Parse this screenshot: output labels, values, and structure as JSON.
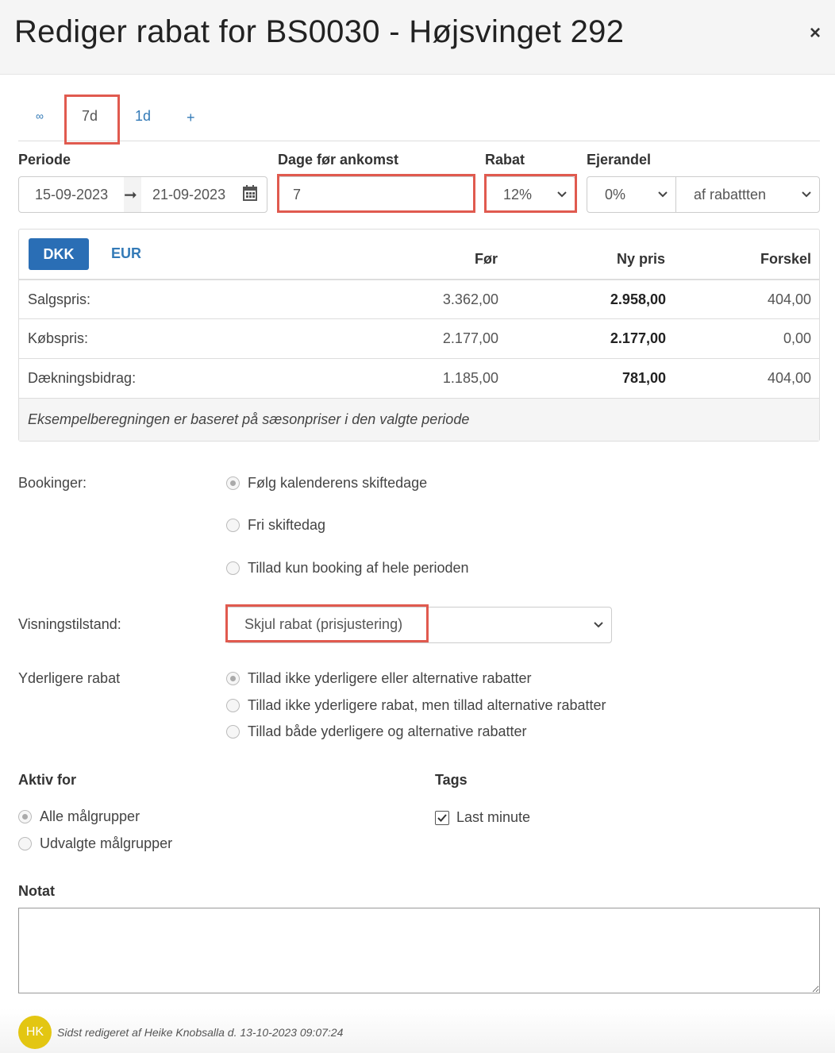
{
  "dialog": {
    "title": "Rediger rabat for BS0030 - Højsvinget 292",
    "close": "×"
  },
  "tabs": [
    {
      "label": "∞"
    },
    {
      "label": "7d",
      "active": true
    },
    {
      "label": "1d"
    },
    {
      "label": "+"
    }
  ],
  "fields": {
    "periode_label": "Periode",
    "date_from": "15-09-2023",
    "date_to": "21-09-2023",
    "dage_label": "Dage før ankomst",
    "dage_value": "7",
    "rabat_label": "Rabat",
    "rabat_value": "12%",
    "ejerandel_label": "Ejerandel",
    "ejerandel_value": "0%",
    "ejerandel_basis": "af rabattten"
  },
  "price_table": {
    "currencies": [
      "DKK",
      "EUR"
    ],
    "active_currency": "DKK",
    "headers": [
      "Før",
      "Ny pris",
      "Forskel"
    ],
    "rows": [
      {
        "label": "Salgspris:",
        "before": "3.362,00",
        "new": "2.958,00",
        "diff": "404,00"
      },
      {
        "label": "Købspris:",
        "before": "2.177,00",
        "new": "2.177,00",
        "diff": "0,00"
      },
      {
        "label": "Dækningsbidrag:",
        "before": "1.185,00",
        "new": "781,00",
        "diff": "404,00"
      }
    ],
    "note": "Eksempelberegningen er baseret på sæsonpriser i den valgte periode"
  },
  "bookinger": {
    "label": "Bookinger:",
    "options": [
      "Følg kalenderens skiftedage",
      "Fri skiftedag",
      "Tillad kun booking af hele perioden"
    ],
    "selected": 0
  },
  "visning": {
    "label": "Visningstilstand:",
    "value": "Skjul rabat (prisjustering)"
  },
  "yderligere": {
    "label": "Yderligere rabat",
    "options": [
      "Tillad ikke yderligere eller alternative rabatter",
      "Tillad ikke yderligere rabat, men tillad alternative rabatter",
      "Tillad både yderligere og alternative rabatter"
    ],
    "selected": 0
  },
  "aktiv": {
    "label": "Aktiv for",
    "options": [
      "Alle målgrupper",
      "Udvalgte målgrupper"
    ],
    "selected": 0
  },
  "tags": {
    "label": "Tags",
    "items": [
      {
        "label": "Last minute",
        "checked": true
      }
    ]
  },
  "notat": {
    "label": "Notat",
    "value": ""
  },
  "footer": {
    "initials": "HK",
    "edited": "Sidst redigeret af Heike Knobsalla d. 13-10-2023 09:07:24"
  },
  "colors": {
    "primary": "#2a6eb5",
    "link": "#337ab7",
    "highlight": "#e05a4f",
    "avatar": "#e3c612"
  }
}
